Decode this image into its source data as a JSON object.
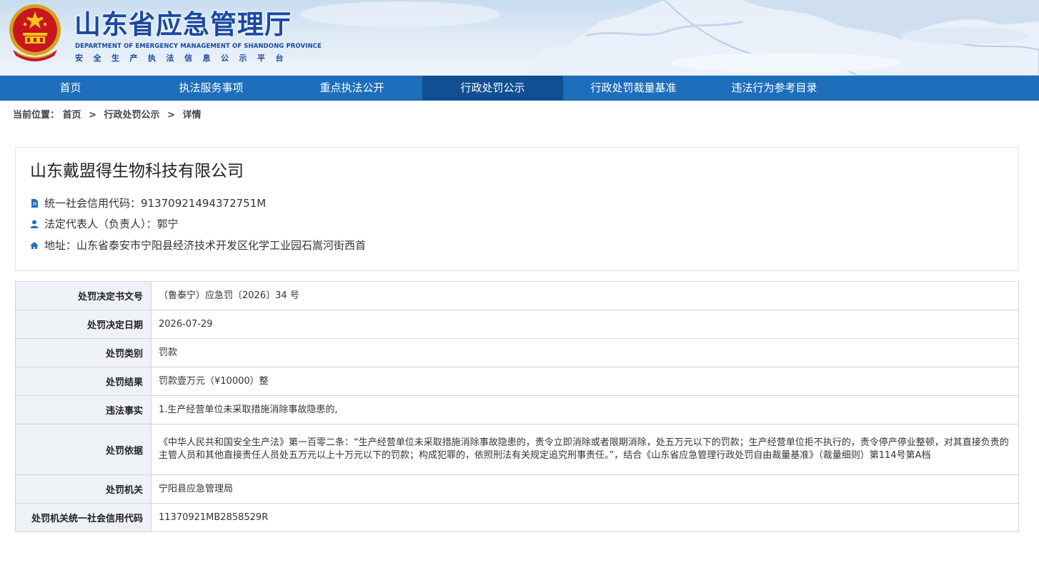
{
  "site": {
    "title": "山东省应急管理厅",
    "title_en": "DEPARTMENT OF EMERGENCY MANAGEMENT OF SHANDONG PROVINCE",
    "subtitle": "安全生产执法信息公示平台"
  },
  "nav": {
    "items": [
      {
        "label": "首页",
        "active": false
      },
      {
        "label": "执法服务事项",
        "active": false
      },
      {
        "label": "重点执法公开",
        "active": false
      },
      {
        "label": "行政处罚公示",
        "active": true
      },
      {
        "label": "行政处罚裁量基准",
        "active": false
      },
      {
        "label": "违法行为参考目录",
        "active": false
      }
    ]
  },
  "breadcrumb": {
    "prefix": "当前位置：",
    "items": [
      "首页",
      "行政处罚公示",
      "详情"
    ],
    "separator": ">"
  },
  "company": {
    "name": "山东戴盟得生物科技有限公司",
    "credit_code": "统一社会信用代码：91370921494372751M",
    "legal_rep": "法定代表人（负责人）：郭宁",
    "address": "地址：山东省泰安市宁阳县经济技术开发区化学工业园石嵩河街西首",
    "icons": [
      "document-icon",
      "user-icon",
      "home-icon"
    ],
    "icon_color": "#1d6ebb"
  },
  "detail": {
    "rows": [
      {
        "key": "处罚决定书文号",
        "value": "（鲁泰宁）应急罚〔2026〕34 号"
      },
      {
        "key": "处罚决定日期",
        "value": "2026-07-29"
      },
      {
        "key": "处罚类别",
        "value": "罚款"
      },
      {
        "key": "处罚结果",
        "value": "罚款壹万元（¥10000）整"
      },
      {
        "key": "违法事实",
        "value": "1.生产经营单位未采取措施消除事故隐患的,"
      },
      {
        "key": "处罚依据",
        "value": "《中华人民共和国安全生产法》第一百零二条：“生产经营单位未采取措施消除事故隐患的，责令立即消除或者限期消除，处五万元以下的罚款；生产经营单位拒不执行的，责令停产停业整顿，对其直接负责的主管人员和其他直接责任人员处五万元以上十万元以下的罚款；构成犯罪的，依照刑法有关规定追究刑事责任。”，结合《山东省应急管理行政处罚自由裁量基准》（裁量细则）第114号第A档"
      },
      {
        "key": "处罚机关",
        "value": "宁阳县应急管理局"
      },
      {
        "key": "处罚机关统一社会信用代码",
        "value": "11370921MB2858529R"
      }
    ]
  },
  "colors": {
    "nav_bg": "#1d6ebb",
    "nav_active_bg": "#0f4f92",
    "title_blue": "#1a49a0",
    "table_key_bg": "#eef1f6"
  }
}
